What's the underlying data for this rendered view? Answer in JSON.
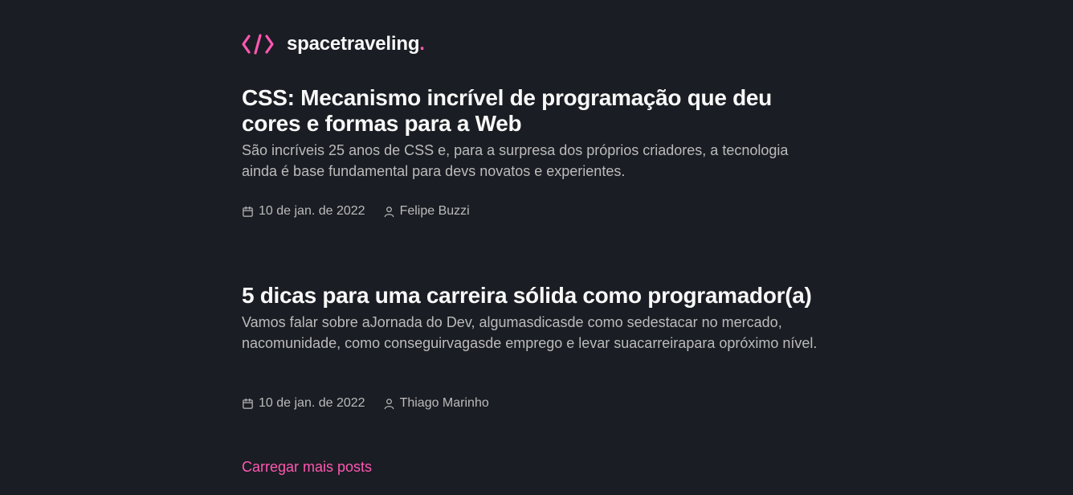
{
  "header": {
    "logo_icon": "code-brackets-icon",
    "brand": "spacetraveling",
    "brand_dot": ".",
    "accent_color": "#ff57b2"
  },
  "posts": [
    {
      "title": "CSS: Mecanismo incrível de programação que deu cores e formas para a Web",
      "subtitle": "São incríveis 25 anos de CSS e, para a surpresa dos próprios criadores, a tecnologia ainda é base fundamental para devs novatos e experientes.",
      "date": "10 de jan. de 2022",
      "author": "Felipe Buzzi"
    },
    {
      "title": "5 dicas para uma carreira sólida como programador(a)",
      "subtitle": "Vamos falar sobre aJornada do Dev, algumasdicasde como sedestacar no mercado, nacomunidade, como conseguirvagasde emprego  e levar suacarreirapara opróximo nível.",
      "date": "10 de jan. de 2022",
      "author": "Thiago Marinho"
    }
  ],
  "load_more_label": "Carregar mais posts",
  "colors": {
    "background": "#1a1d23",
    "heading": "#f8f8f8",
    "body_text": "#bbbbbb",
    "accent": "#ff57b2"
  }
}
